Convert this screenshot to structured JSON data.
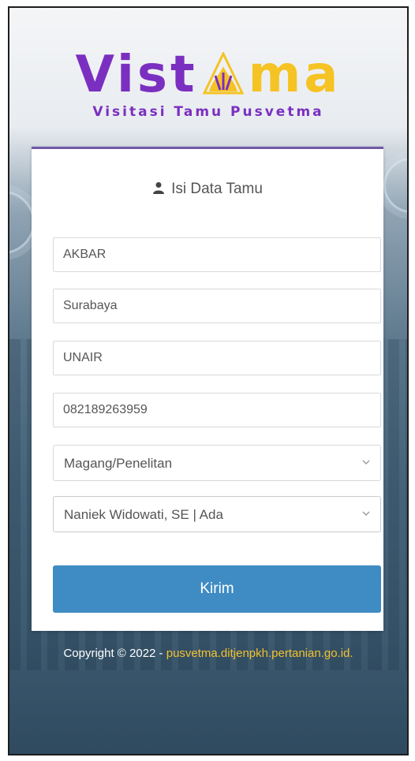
{
  "logo": {
    "word_left": "Vist",
    "word_right": "ma",
    "subtitle": "Visitasi Tamu Pusvetma"
  },
  "form": {
    "title": "Isi Data Tamu",
    "fields": {
      "name": "AKBAR",
      "city": "Surabaya",
      "institution": "UNAIR",
      "phone": "082189263959"
    },
    "purpose_selected": "Magang/Penelitan",
    "host_selected": "Naniek Widowati, SE | Ada",
    "submit_label": "Kirim"
  },
  "footer": {
    "copyright": "Copyright © 2022 - ",
    "link_text": "pusvetma.ditjenpkh.pertanian.go.id."
  },
  "colors": {
    "brand_purple": "#7b2fc0",
    "brand_yellow": "#f5c323",
    "button_blue": "#3f8bc3",
    "card_border": "#6f5aa8"
  }
}
